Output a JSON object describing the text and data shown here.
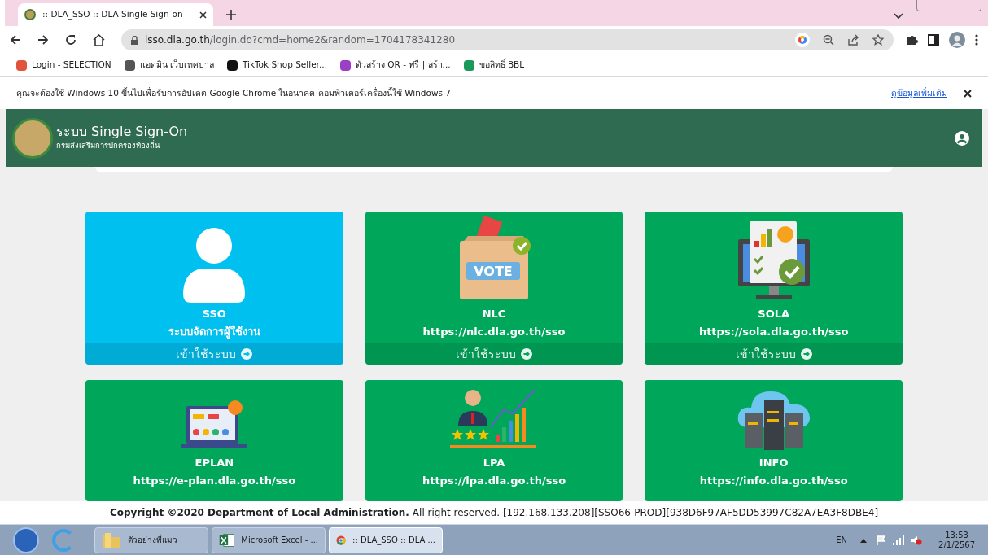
{
  "browser": {
    "tabs": [
      {
        "title": ":: DLA_SSO :: DLA Single Sign-on",
        "selected": true
      }
    ],
    "address": {
      "host": "lsso.dla.go.th",
      "path": "/login.do?cmd=home2&random=1704178341280"
    },
    "bookmarks": [
      {
        "label": "Login - SELECTION",
        "color": "#e0533d"
      },
      {
        "label": "แอดมิน เว็บเทศบาล",
        "color": "#555555"
      },
      {
        "label": "TikTok Shop Seller...",
        "color": "#111111"
      },
      {
        "label": "ตัวสร้าง QR - ฟรี | สร้า...",
        "color": "#9b3fc4"
      },
      {
        "label": "ขอสิทธิ์ BBL",
        "color": "#1a9a5a"
      }
    ],
    "infobar": {
      "message": "คุณจะต้องใช้ Windows 10 ขึ้นไปเพื่อรับการอัปเดต Google Chrome ในอนาคต คอมพิวเตอร์เครื่องนี้ใช้ Windows 7",
      "link": "ดูข้อมูลเพิ่มเติม"
    }
  },
  "header": {
    "title": "ระบบ Single Sign-On",
    "subtitle": "กรมส่งเสริมการปกครองท้องถิ่น"
  },
  "cards": [
    {
      "kind": "user",
      "name": "SSO",
      "description": "ระบบจัดการผู้ใช้งาน",
      "button": "เข้าใช้ระบบ",
      "color": "#00c0ef"
    },
    {
      "kind": "vote",
      "icon_label": "VOTE",
      "name": "NLC",
      "description": "https://nlc.dla.go.th/sso",
      "button": "เข้าใช้ระบบ",
      "color": "#00a65a"
    },
    {
      "kind": "monitor",
      "name": "SOLA",
      "description": "https://sola.dla.go.th/sso",
      "button": "เข้าใช้ระบบ",
      "color": "#00a65a"
    },
    {
      "kind": "plan",
      "name": "EPLAN",
      "description": "https://e-plan.dla.go.th/sso",
      "color": "#00a65a"
    },
    {
      "kind": "chart",
      "name": "LPA",
      "description": "https://lpa.dla.go.th/sso",
      "color": "#00a65a"
    },
    {
      "kind": "cloud",
      "name": "INFO",
      "description": "https://info.dla.go.th/sso",
      "color": "#00a65a"
    }
  ],
  "footer": {
    "copyright": "Copyright ©2020 Department of Local Administration.",
    "rest": "All right reserved. [192.168.133.208][SSO66-PROD][938D6F97AF5DD53997C82A7EA3F8DBE4]"
  },
  "taskbar": {
    "tasks": [
      {
        "kind": "folder",
        "label": "ตัวอย่างพี่แมว",
        "selected": false
      },
      {
        "kind": "excel",
        "label": "Microsoft Excel - ...",
        "selected": false
      },
      {
        "kind": "chrome",
        "label": ":: DLA_SSO :: DLA ...",
        "selected": true
      }
    ],
    "language": "EN",
    "time": "13:53",
    "date": "2/1/2567"
  }
}
